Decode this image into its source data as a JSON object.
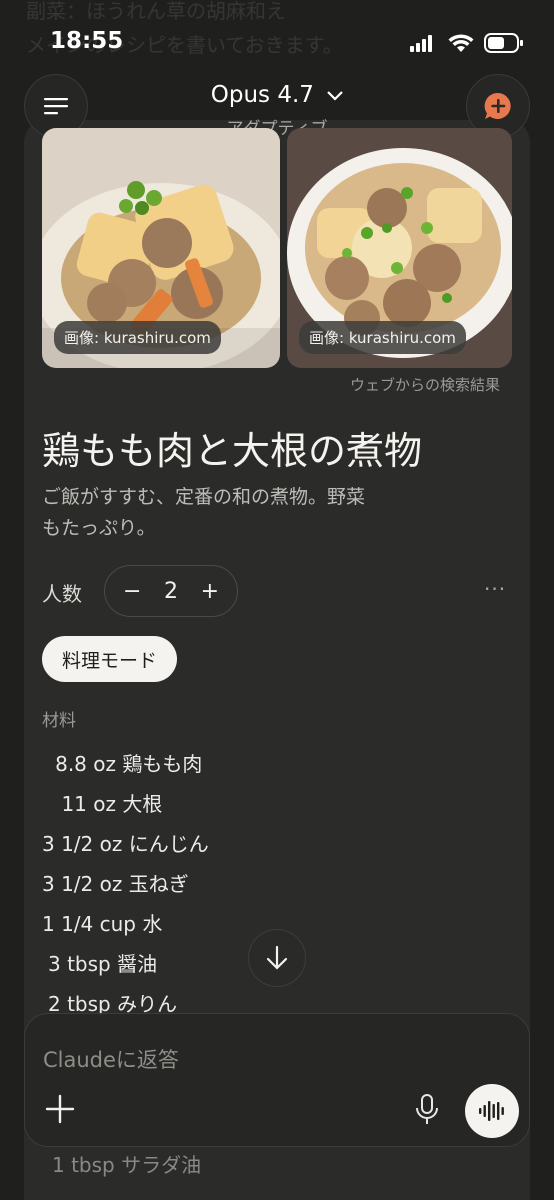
{
  "bg": {
    "line1": "副菜：ほうれん草の胡麻和え",
    "line2": "メインのレシピを書いておきます。"
  },
  "status": {
    "time": "18:55"
  },
  "header": {
    "model": "Opus 4.7",
    "mode": "アダプティブ",
    "menu_icon": "hamburger-icon",
    "new_chat_icon": "plus-bubble-icon",
    "accent": "#e8784e"
  },
  "images": [
    {
      "caption": "画像: kurashiru.com"
    },
    {
      "caption": "画像: kurashiru.com"
    }
  ],
  "web_result_label": "ウェブからの検索結果",
  "recipe": {
    "title": "鶏もも肉と大根の煮物",
    "description_line1": "ご飯がすすむ、定番の和の煮物。野菜",
    "description_line2": "もたっぷり。",
    "servings_label": "人数",
    "servings_value": "2",
    "minus": "−",
    "plus": "+",
    "more": "···",
    "cook_mode_label": "料理モード",
    "ingredients_heading": "材料",
    "ingredients": [
      {
        "qty": "8.8 oz",
        "name": "鶏もも肉"
      },
      {
        "qty": "11 oz",
        "name": "大根"
      },
      {
        "qty": "3 1/2 oz",
        "name": "にんじん"
      },
      {
        "qty": "3 1/2 oz",
        "name": "玉ねぎ"
      },
      {
        "qty": "1 1/4 cup",
        "name": "水"
      },
      {
        "qty": "3 tbsp",
        "name": "醤油"
      },
      {
        "qty": "2 tbsp",
        "name": "みりん"
      }
    ],
    "hidden_row": {
      "qty": "1 tbsp",
      "name": "サラダ油"
    }
  },
  "composer": {
    "placeholder": "Claudeに返答"
  }
}
